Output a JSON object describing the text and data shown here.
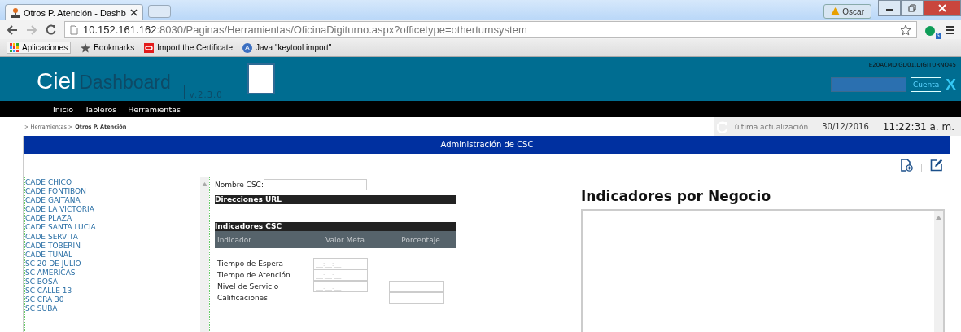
{
  "browser": {
    "tabs": [
      {
        "title": "Otros P. Atención - Dashb",
        "selected": true
      }
    ],
    "profile_badge": "Oscar",
    "url": {
      "host": "10.152.161.162",
      "rest": ":8030/Paginas/Herramientas/OficinaDigiturno.aspx?officetype=otherturnsystem"
    },
    "extension_badge": "5",
    "bookmarks": [
      {
        "kind": "apps",
        "label": "Aplicaciones"
      },
      {
        "kind": "star",
        "label": "Bookmarks"
      },
      {
        "kind": "oracle",
        "label": "Import the Certificate"
      },
      {
        "kind": "letter",
        "glyph": "A",
        "label": "Java \"keytool import\""
      }
    ]
  },
  "header": {
    "brand": "Ciel",
    "product": "Dashboard",
    "version": "v.2.3.0",
    "user": "E20ACMDIGD01.DIGITURNO45",
    "account_button": "Cuenta",
    "close": "X"
  },
  "nav": [
    "Inicio",
    "Tableros",
    "Herramientas"
  ],
  "breadcrumb": {
    "parent": "> Herramientas >",
    "current": "Otros P. Atención"
  },
  "status": {
    "label": "última actualización",
    "date": "30/12/2016",
    "time": "11:22:31 a. m."
  },
  "panel": {
    "title": "Administración de CSC",
    "offices": [
      "CADE CHICO",
      "CADE FONTIBON",
      "CADE GAITANA",
      "CADE LA VICTORIA",
      "CADE PLAZA",
      "CADE SANTA LUCIA",
      "CADE SERVITA",
      "CADE TOBERIN",
      "CADE TUNAL",
      "SC 20 DE JULIO",
      "SC AMERICAS",
      "SC BOSA",
      "SC CALLE 13",
      "SC CRA 30",
      "SC SUBA"
    ],
    "name_label": "Nombre CSC:",
    "urls_heading": "Direcciones URL",
    "indicators_heading": "Indicadores CSC",
    "columns": [
      "Indicador",
      "Valor Meta",
      "Porcentaje"
    ],
    "indicators": [
      {
        "label": "Tiempo de Espera",
        "time_placeholder": "__:__:__"
      },
      {
        "label": "Tiempo de Atención",
        "time_placeholder": "__:__:__"
      },
      {
        "label": "Nivel de Servicio",
        "time_placeholder": "__:__:__",
        "percent": true
      },
      {
        "label": "Calificaciones",
        "percent": true
      }
    ],
    "business_heading": "Indicadores por Negocio"
  }
}
